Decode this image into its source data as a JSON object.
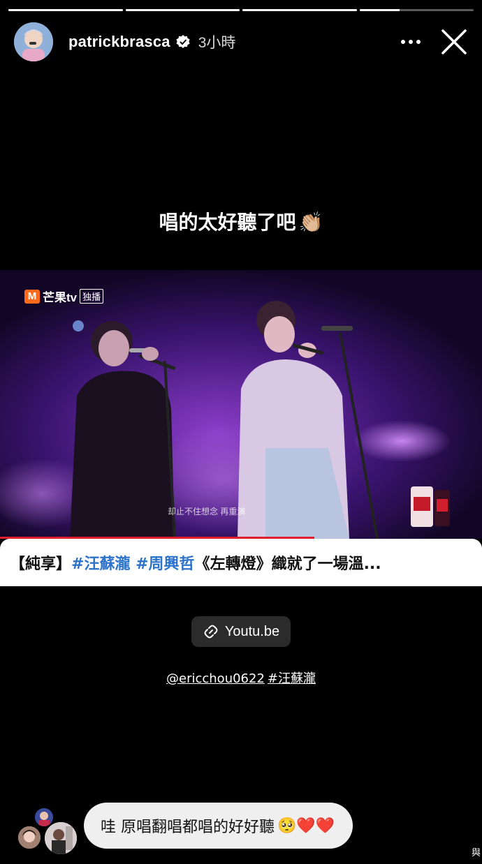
{
  "progress_segments": [
    1,
    1,
    1,
    0.35
  ],
  "header": {
    "username": "patrickbrasca",
    "time": "3小時"
  },
  "caption": {
    "text": "唱的太好聽了吧",
    "emoji": "👏🏼"
  },
  "video": {
    "logo_name": "芒果tv",
    "logo_tag": "独播",
    "subtitle": "却止不住想念  再重演"
  },
  "link_title": {
    "prefix": "【純享】",
    "hashtag1": "#汪蘇瀧",
    "hashtag2": "#周興哲",
    "rest": "《左轉燈》織就了一場溫..."
  },
  "link_sticker": {
    "label": "Youtu.be"
  },
  "mentions": {
    "user": "@ericchou0622",
    "tag": "#汪蘇瀧"
  },
  "comment": {
    "text": "哇 原唱翻唱都唱的好好聽",
    "emojis": "🥺❤️❤️"
  },
  "corner_text": "與"
}
